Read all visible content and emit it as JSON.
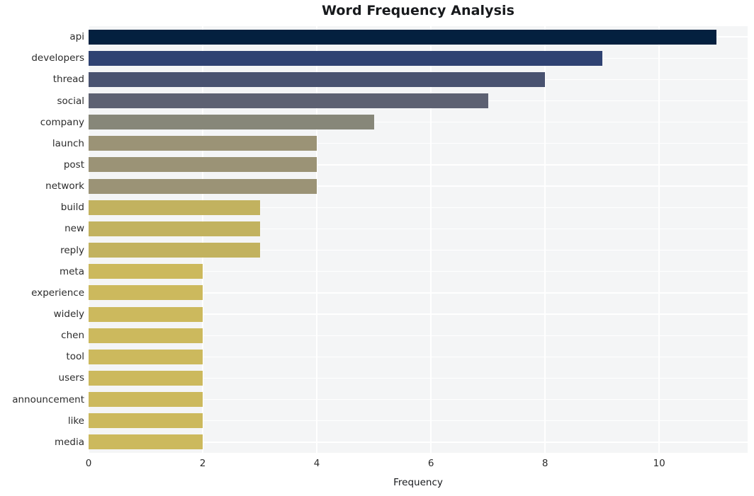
{
  "chart_data": {
    "type": "bar",
    "orientation": "horizontal",
    "title": "Word Frequency Analysis",
    "xlabel": "Frequency",
    "ylabel": "",
    "categories": [
      "api",
      "developers",
      "thread",
      "social",
      "company",
      "launch",
      "post",
      "network",
      "build",
      "new",
      "reply",
      "meta",
      "experience",
      "widely",
      "chen",
      "tool",
      "users",
      "announcement",
      "like",
      "media"
    ],
    "values": [
      11,
      9,
      8,
      7,
      5,
      4,
      4,
      4,
      3,
      3,
      3,
      2,
      2,
      2,
      2,
      2,
      2,
      2,
      2,
      2
    ],
    "bar_colors": [
      "#04203f",
      "#2f4272",
      "#495270",
      "#5d6172",
      "#878779",
      "#9b9376",
      "#9b9376",
      "#9b9376",
      "#c2b25f",
      "#c2b25f",
      "#c2b25f",
      "#ccb95d",
      "#ccb95d",
      "#ccb95d",
      "#ccb95d",
      "#ccb95d",
      "#ccb95d",
      "#ccb95d",
      "#ccb95d",
      "#ccb95d"
    ],
    "xticks": [
      0,
      2,
      4,
      6,
      8,
      10
    ],
    "xtick_labels": [
      "0",
      "2",
      "4",
      "6",
      "8",
      "10"
    ],
    "xlim": [
      0,
      11.55
    ],
    "grid": true,
    "grid_color": "#ffffff",
    "plot_background": "#f4f5f6",
    "figure_background": "#ffffff",
    "legend": null
  }
}
